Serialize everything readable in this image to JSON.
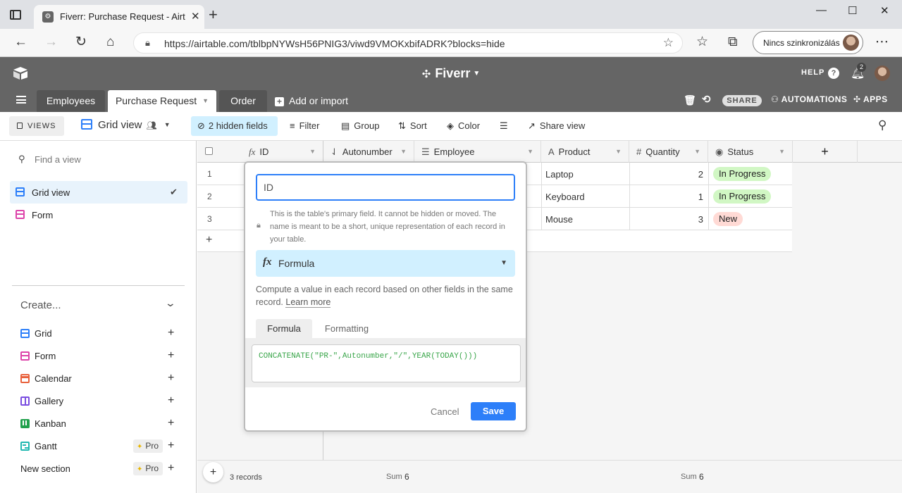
{
  "browser": {
    "tab_title": "Fiverr: Purchase Request - Airtable",
    "tab_close": "✕",
    "new_tab": "+",
    "url": "https://airtable.com/tblbpNYWsH56PNIG3/viwd9VMOKxbifADRK?blocks=hide",
    "sync_label": "Nincs szinkronizálás"
  },
  "header": {
    "base_name": "Fiverr",
    "help_label": "HELP",
    "notification_count": "2",
    "share_label": "SHARE",
    "automations_label": "AUTOMATIONS",
    "apps_label": "APPS",
    "add_import_label": "Add or import",
    "tables": [
      {
        "label": "Employees"
      },
      {
        "label": "Purchase Request"
      },
      {
        "label": "Order"
      }
    ]
  },
  "viewbar": {
    "views_label": "VIEWS",
    "view_name": "Grid view",
    "hidden_fields": "2 hidden fields",
    "filter": "Filter",
    "group": "Group",
    "sort": "Sort",
    "color": "Color",
    "share_view": "Share view"
  },
  "sidebar": {
    "find_placeholder": "Find a view",
    "views": [
      {
        "label": "Grid view"
      },
      {
        "label": "Form"
      }
    ],
    "create_label": "Create...",
    "create_items": [
      {
        "label": "Grid"
      },
      {
        "label": "Form"
      },
      {
        "label": "Calendar"
      },
      {
        "label": "Gallery"
      },
      {
        "label": "Kanban"
      },
      {
        "label": "Gantt",
        "badge": "Pro"
      },
      {
        "label": "New section",
        "badge": "Pro"
      }
    ]
  },
  "grid": {
    "columns": [
      {
        "label": "ID"
      },
      {
        "label": "Autonumber"
      },
      {
        "label": "Employee"
      },
      {
        "label": "Product"
      },
      {
        "label": "Quantity"
      },
      {
        "label": "Status"
      }
    ],
    "rows": [
      {
        "num": "1",
        "product": "Laptop",
        "quantity": "2",
        "status": "In Progress"
      },
      {
        "num": "2",
        "product": "Keyboard",
        "quantity": "1",
        "status": "In Progress"
      },
      {
        "num": "3",
        "product": "Mouse",
        "quantity": "3",
        "status": "New"
      }
    ],
    "records_count": "3 records",
    "sum_label": "Sum",
    "sum_autonumber": "6",
    "sum_quantity": "6"
  },
  "colors": {
    "accent": "#2d7ff9",
    "status_in_progress": "#d1f7c4",
    "status_new": "#ffdad5",
    "header_bg": "#656565"
  },
  "field_editor": {
    "field_name": "ID",
    "primary_note": "This is the table's primary field. It cannot be hidden or moved. The name is meant to be a short, unique representation of each record in your table.",
    "type_label": "Formula",
    "type_description": "Compute a value in each record based on other fields in the same record.",
    "learn_more": "Learn more",
    "tab_formula": "Formula",
    "tab_formatting": "Formatting",
    "formula": "CONCATENATE(\"PR-\",Autonumber,\"/\",YEAR(TODAY()))",
    "cancel_label": "Cancel",
    "save_label": "Save"
  }
}
